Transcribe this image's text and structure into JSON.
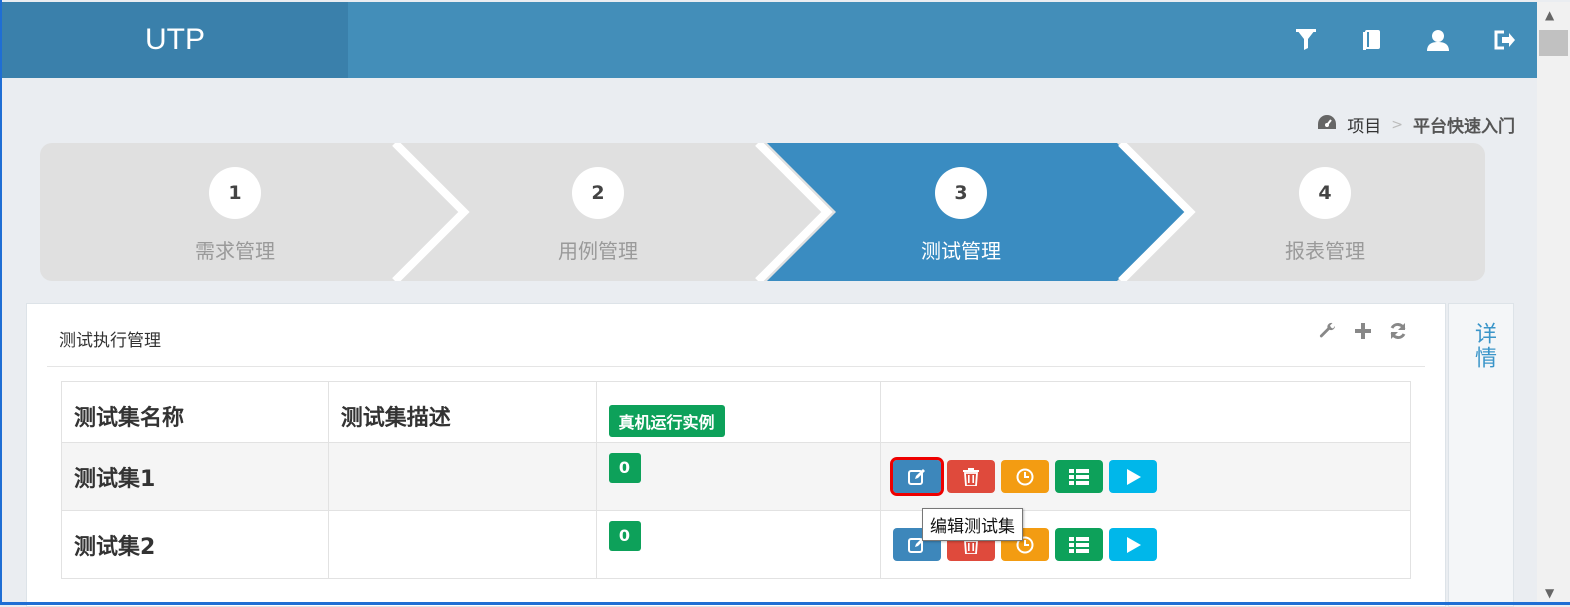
{
  "app": {
    "brand": "UTP"
  },
  "topbar": {
    "icons": [
      "filter-icon",
      "book-icon",
      "user-icon",
      "logout-icon"
    ]
  },
  "breadcrumb": {
    "home": "项目",
    "separator": ">",
    "current": "平台快速入门"
  },
  "wizard": {
    "active_index": 2,
    "steps": [
      {
        "number": "1",
        "label": "需求管理"
      },
      {
        "number": "2",
        "label": "用例管理"
      },
      {
        "number": "3",
        "label": "测试管理"
      },
      {
        "number": "4",
        "label": "报表管理"
      }
    ]
  },
  "panel": {
    "title": "测试执行管理",
    "tools": [
      "wrench-icon",
      "plus-icon",
      "refresh-icon"
    ]
  },
  "table": {
    "headers": {
      "name": "测试集名称",
      "desc": "测试集描述",
      "device_tag": "真机运行实例",
      "actions": ""
    },
    "rows": [
      {
        "name": "测试集1",
        "desc": "",
        "count": "0"
      },
      {
        "name": "测试集2",
        "desc": "",
        "count": "0"
      }
    ]
  },
  "tooltip": {
    "text": "编辑测试集"
  },
  "side_tab": {
    "label": "详情"
  },
  "colors": {
    "primary": "#438eb9",
    "edit": "#3d87bb",
    "delete": "#df4a3c",
    "schedule": "#f39c12",
    "list": "#0da15a",
    "run": "#00b7ea"
  }
}
